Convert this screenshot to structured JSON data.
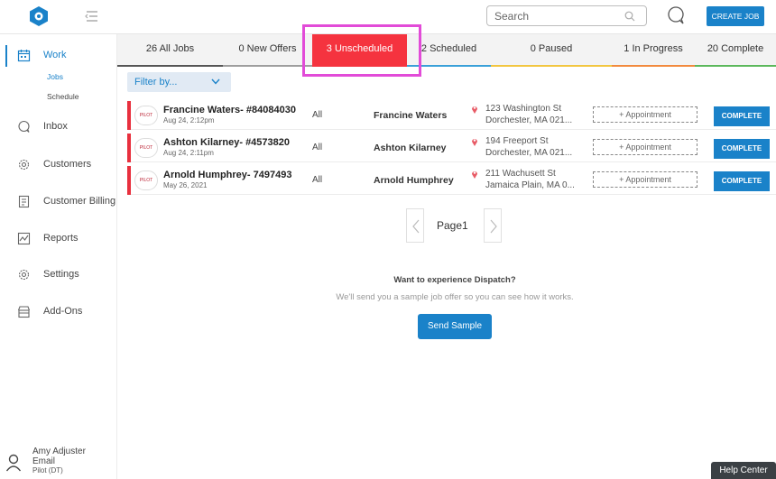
{
  "topbar": {
    "search_placeholder": "Search",
    "create_job": "CREATE JOB"
  },
  "sidebar": {
    "items": [
      {
        "label": "Work",
        "icon": "calendar-icon"
      },
      {
        "label": "Inbox",
        "icon": "chat-icon"
      },
      {
        "label": "Customers",
        "icon": "gear-icon"
      },
      {
        "label": "Customer Billing",
        "icon": "document-icon"
      },
      {
        "label": "Reports",
        "icon": "chart-icon"
      },
      {
        "label": "Settings",
        "icon": "settings-icon"
      },
      {
        "label": "Add-Ons",
        "icon": "store-icon"
      }
    ],
    "subitems": [
      {
        "label": "Jobs",
        "active": true
      },
      {
        "label": "Schedule",
        "active": false
      }
    ],
    "user": {
      "name": "Amy Adjuster",
      "email": "Email",
      "role": "Pilot (DT)"
    }
  },
  "tabs": [
    {
      "label": "26 All Jobs",
      "color": "#555555"
    },
    {
      "label": "0 New Offers",
      "color": "#9e9e9e"
    },
    {
      "label": "3 Unscheduled",
      "color": "#f5333f",
      "active": true
    },
    {
      "label": "2 Scheduled",
      "color": "#3aa0d8"
    },
    {
      "label": "0 Paused",
      "color": "#f2c640"
    },
    {
      "label": "1 In Progress",
      "color": "#f28a3e"
    },
    {
      "label": "20 Complete",
      "color": "#5cb85c"
    }
  ],
  "filter": {
    "label": "Filter by..."
  },
  "logo_badge": "PILOT",
  "jobs": [
    {
      "title": "Francine Waters- #84084030",
      "date": "Aug 24, 2:12pm",
      "type": "All",
      "customer": "Francine Waters",
      "address1": "123 Washington St",
      "address2": "Dorchester, MA 021...",
      "appointment": "+ Appointment",
      "action": "COMPLETE"
    },
    {
      "title": "Ashton Kilarney- #4573820",
      "date": "Aug 24, 2:11pm",
      "type": "All",
      "customer": "Ashton Kilarney",
      "address1": "194 Freeport St",
      "address2": "Dorchester, MA 021...",
      "appointment": "+ Appointment",
      "action": "COMPLETE"
    },
    {
      "title": "Arnold Humphrey- 7497493",
      "date": "May 26, 2021",
      "type": "All",
      "customer": "Arnold Humphrey",
      "address1": "211 Wachusett St",
      "address2": "Jamaica Plain, MA 0...",
      "appointment": "+ Appointment",
      "action": "COMPLETE"
    }
  ],
  "pagination": {
    "label": "Page1"
  },
  "promo": {
    "title": "Want to experience Dispatch?",
    "subtitle": "We'll send you a sample job offer so you can see how it works.",
    "button": "Send Sample"
  },
  "help": "Help Center",
  "colors": {
    "accent": "#1a82c9",
    "alert": "#f5333f",
    "highlight": "#e24bd8"
  }
}
